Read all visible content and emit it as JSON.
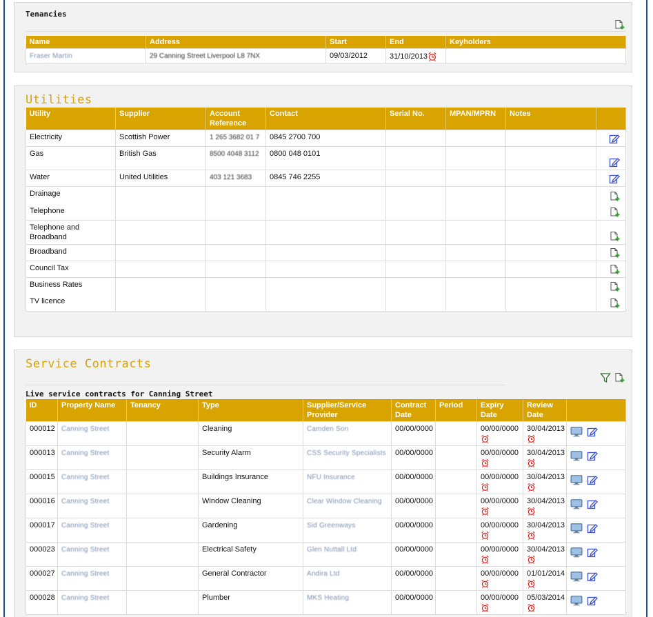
{
  "tenancies": {
    "title": "Tenancies",
    "columns": [
      "Name",
      "Address",
      "Start",
      "End",
      "Keyholders"
    ],
    "rows": [
      {
        "name": "Fraser Martin",
        "address": "29 Canning Street Liverpool L8 7NX",
        "start": "09/03/2012",
        "end": "31/10/2013",
        "keyholders": ""
      }
    ]
  },
  "utilities": {
    "title": "Utilities",
    "columns": [
      "Utility",
      "Supplier",
      "Account Reference",
      "Contact",
      "Serial No.",
      "MPAN/MPRN",
      "Notes",
      ""
    ],
    "rows": [
      {
        "utility": "Electricity",
        "supplier": "Scottish Power",
        "account": "1 265 3682 01 7",
        "contact": "0845 2700 700",
        "serial": "",
        "mpan": "",
        "notes": "",
        "action": "edit"
      },
      {
        "utility": "Gas",
        "supplier": "British Gas",
        "account": "8500 4048 3112",
        "contact": "0800 048 0101",
        "serial": "",
        "mpan": "",
        "notes": "",
        "action": "edit"
      },
      {
        "utility": "Water",
        "supplier": "United Utilities",
        "account": "403 121 3683",
        "contact": "0845 746 2255",
        "serial": "",
        "mpan": "",
        "notes": "",
        "action": "edit"
      },
      {
        "utility": "Drainage",
        "supplier": "",
        "account": "",
        "contact": "",
        "serial": "",
        "mpan": "",
        "notes": "",
        "action": "add"
      },
      {
        "utility": "Telephone",
        "supplier": "",
        "account": "",
        "contact": "",
        "serial": "",
        "mpan": "",
        "notes": "",
        "action": "add"
      },
      {
        "utility": "Telephone and Broadband",
        "supplier": "",
        "account": "",
        "contact": "",
        "serial": "",
        "mpan": "",
        "notes": "",
        "action": "add"
      },
      {
        "utility": "Broadband",
        "supplier": "",
        "account": "",
        "contact": "",
        "serial": "",
        "mpan": "",
        "notes": "",
        "action": "add"
      },
      {
        "utility": "Council Tax",
        "supplier": "",
        "account": "",
        "contact": "",
        "serial": "",
        "mpan": "",
        "notes": "",
        "action": "add"
      },
      {
        "utility": "Business Rates",
        "supplier": "",
        "account": "",
        "contact": "",
        "serial": "",
        "mpan": "",
        "notes": "",
        "action": "add"
      },
      {
        "utility": "TV licence",
        "supplier": "",
        "account": "",
        "contact": "",
        "serial": "",
        "mpan": "",
        "notes": "",
        "action": "add"
      }
    ]
  },
  "contracts": {
    "title": "Service Contracts",
    "subtitle": "Live service contracts for Canning Street",
    "columns": [
      "ID",
      "Property Name",
      "Tenancy",
      "Type",
      "Supplier/Service Provider",
      "Contract Date",
      "Period",
      "Expiry Date",
      "Review Date",
      ""
    ],
    "rows": [
      {
        "id": "000012",
        "property": "Canning Street",
        "tenancy": "",
        "type": "Cleaning",
        "supplier": "Camden Son",
        "contract_date": "00/00/0000",
        "period": "",
        "expiry": "00/00/0000",
        "review": "30/04/2013"
      },
      {
        "id": "000013",
        "property": "Canning Street",
        "tenancy": "",
        "type": "Security Alarm",
        "supplier": "CSS Security Specialists",
        "contract_date": "00/00/0000",
        "period": "",
        "expiry": "00/00/0000",
        "review": "30/04/2013"
      },
      {
        "id": "000015",
        "property": "Canning Street",
        "tenancy": "",
        "type": "Buildings Insurance",
        "supplier": "NFU Insurance",
        "contract_date": "00/00/0000",
        "period": "",
        "expiry": "00/00/0000",
        "review": "30/04/2013"
      },
      {
        "id": "000016",
        "property": "Canning Street",
        "tenancy": "",
        "type": "Window Cleaning",
        "supplier": "Clear Window Cleaning",
        "contract_date": "00/00/0000",
        "period": "",
        "expiry": "00/00/0000",
        "review": "30/04/2013"
      },
      {
        "id": "000017",
        "property": "Canning Street",
        "tenancy": "",
        "type": "Gardening",
        "supplier": "Sid Greenways",
        "contract_date": "00/00/0000",
        "period": "",
        "expiry": "00/00/0000",
        "review": "30/04/2013"
      },
      {
        "id": "000023",
        "property": "Canning Street",
        "tenancy": "",
        "type": "Electrical Safety",
        "supplier": "Glen Nuttall Ltd",
        "contract_date": "00/00/0000",
        "period": "",
        "expiry": "00/00/0000",
        "review": "30/04/2013"
      },
      {
        "id": "000027",
        "property": "Canning Street",
        "tenancy": "",
        "type": "General Contractor",
        "supplier": "Andira Ltd",
        "contract_date": "00/00/0000",
        "period": "",
        "expiry": "00/00/0000",
        "review": "01/01/2014"
      },
      {
        "id": "000028",
        "property": "Canning Street",
        "tenancy": "",
        "type": "Plumber",
        "supplier": "MKS Heating",
        "contract_date": "00/00/0000",
        "period": "",
        "expiry": "00/00/0000",
        "review": "05/03/2014"
      }
    ]
  },
  "icons": {
    "add": "add-document-icon",
    "edit": "edit-icon",
    "alarm": "alarm-clock-icon",
    "view": "monitor-view-icon",
    "filter": "filter-icon"
  },
  "colors": {
    "header": "#d9a400",
    "title": "#d9a400",
    "alarm": "#e0201c",
    "edit": "#3a50c8",
    "add": "#2e9e2e",
    "frame": "#1f4f8f"
  }
}
